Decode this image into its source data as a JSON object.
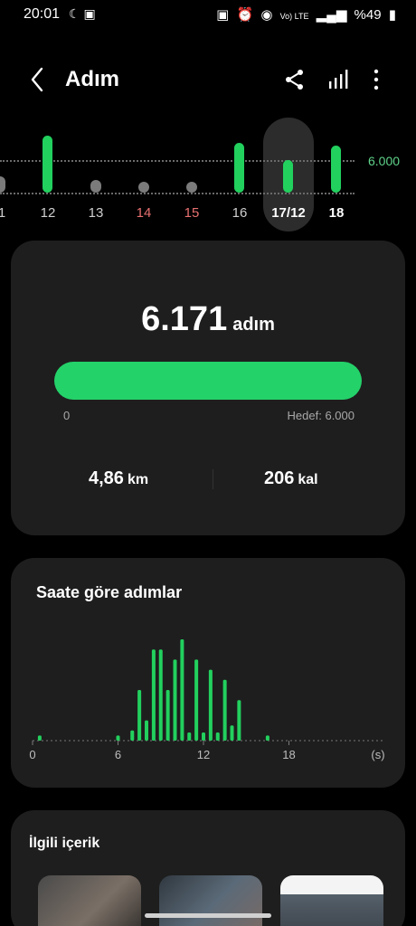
{
  "status": {
    "time": "20:01",
    "left_icons": "☾ ▣",
    "right_icons": [
      "▣",
      "⏰",
      "◉"
    ],
    "network": "Vo) LTE",
    "battery": "%49"
  },
  "header": {
    "title": "Adım"
  },
  "days": {
    "goal_label": "6.000",
    "labels": [
      "1",
      "12",
      "13",
      "14",
      "15",
      "16",
      "17/12",
      "18"
    ],
    "selected": "17/12"
  },
  "summary": {
    "steps": "6.171",
    "steps_unit": "adım",
    "progress_min": "0",
    "progress_goal": "Hedef: 6.000",
    "progress_fraction": 1.0,
    "distance": "4,86",
    "distance_unit": "km",
    "calories": "206",
    "calories_unit": "kal"
  },
  "hourly": {
    "title": "Saate göre adımlar"
  },
  "related": {
    "title": "İlgili içerik"
  },
  "colors": {
    "accent_green": "#22d05e",
    "card_bg": "#1e1e1e",
    "weekend_red": "#e87070"
  },
  "chart_data": {
    "type": "bar",
    "title": "Saate göre adımlar",
    "x_ticks": [
      "0",
      "6",
      "12",
      "18",
      "(s)"
    ],
    "xlim": [
      0,
      24
    ],
    "x": [
      0.5,
      6,
      7,
      7.5,
      8,
      8.5,
      9,
      9.5,
      10,
      10.5,
      11,
      11.5,
      12,
      12.5,
      13,
      13.5,
      14,
      14.5,
      16.5
    ],
    "values": [
      5,
      5,
      10,
      50,
      20,
      90,
      90,
      50,
      80,
      100,
      8,
      80,
      8,
      70,
      8,
      60,
      15,
      40,
      5
    ]
  }
}
